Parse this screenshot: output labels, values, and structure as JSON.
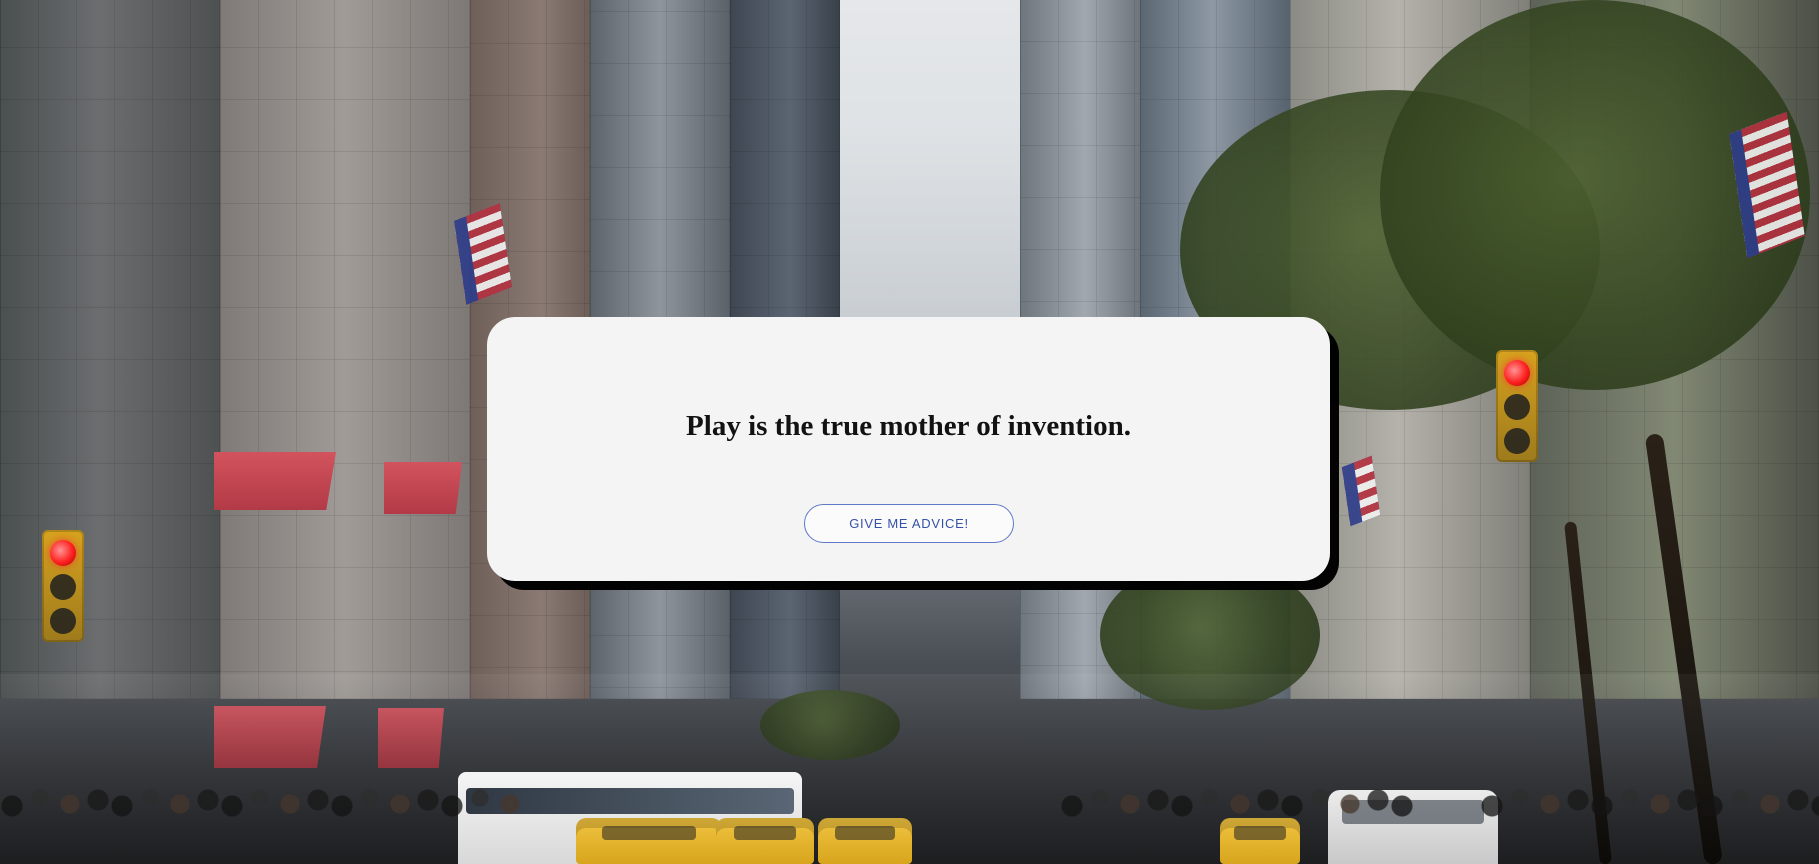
{
  "quote_card": {
    "quote": "Play is the true mother of invention.",
    "button_label": "GIVE ME ADVICE!"
  }
}
